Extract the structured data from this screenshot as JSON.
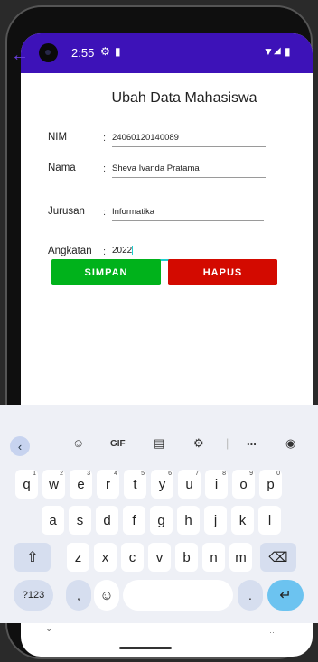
{
  "status": {
    "time": "2:55"
  },
  "form": {
    "title": "Ubah Data Mahasiswa",
    "colon": ":",
    "fields": [
      {
        "label": "NIM",
        "value": "24060120140089"
      },
      {
        "label": "Nama",
        "value": "Sheva Ivanda Pratama"
      },
      {
        "label": "Jurusan",
        "value": "Informatika"
      },
      {
        "label": "Angkatan",
        "value": "2022"
      }
    ],
    "save_label": "SIMPAN",
    "delete_label": "HAPUS",
    "colors": {
      "save": "#00b21b",
      "delete": "#d30a00",
      "status_bar": "#3d12b8",
      "accent": "#1ecfcf"
    }
  },
  "keyboard": {
    "toolbar": {
      "gif_label": "GIF",
      "more_label": "..."
    },
    "row1": [
      {
        "key": "q",
        "hint": "1"
      },
      {
        "key": "w",
        "hint": "2"
      },
      {
        "key": "e",
        "hint": "3"
      },
      {
        "key": "r",
        "hint": "4"
      },
      {
        "key": "t",
        "hint": "5"
      },
      {
        "key": "y",
        "hint": "6"
      },
      {
        "key": "u",
        "hint": "7"
      },
      {
        "key": "i",
        "hint": "8"
      },
      {
        "key": "o",
        "hint": "9"
      },
      {
        "key": "p",
        "hint": "0"
      }
    ],
    "row2": [
      "a",
      "s",
      "d",
      "f",
      "g",
      "h",
      "j",
      "k",
      "l"
    ],
    "row3": [
      "z",
      "x",
      "c",
      "v",
      "b",
      "n",
      "m"
    ],
    "symbols_label": "?123",
    "comma_label": ",",
    "period_label": "."
  }
}
